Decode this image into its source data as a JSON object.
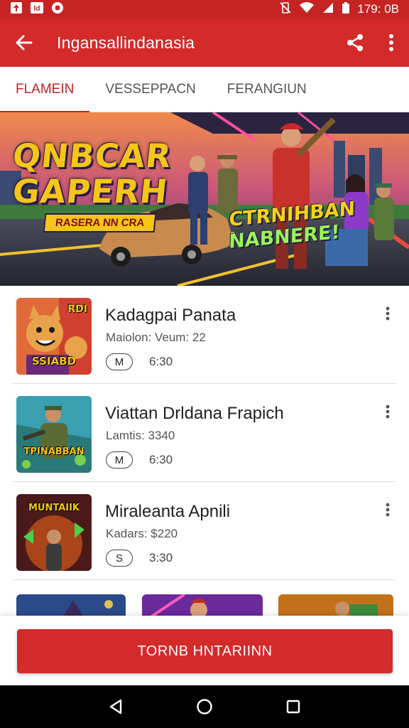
{
  "status_bar": {
    "time": "179: 0B",
    "icons": [
      "notification-icon",
      "image-icon",
      "circle-app-icon",
      "vibrate-off-icon",
      "wifi-icon",
      "signal-icon",
      "battery-icon"
    ]
  },
  "app_bar": {
    "title": "Ingansallindanasia",
    "back_icon": "arrow-left-icon",
    "share_icon": "share-icon",
    "more_icon": "more-vert-icon"
  },
  "tabs": [
    {
      "label": "FLAMEIN",
      "active": true
    },
    {
      "label": "VESSEPPACN",
      "active": false
    },
    {
      "label": "FERANGIUN",
      "active": false
    }
  ],
  "banner": {
    "title_line1": "QNBCAR",
    "title_line2": "GAPERH",
    "subtitle": "RASERA NN CRA",
    "slogan_line1": "CTRNIHBAN",
    "slogan_line2": "NABNERE!"
  },
  "items": [
    {
      "title": "Kadagpai Panata",
      "subtitle": "Maiolon: Veum: 22",
      "badge": "M",
      "time": "6:30",
      "thumb_top": "RDI",
      "thumb_caption": "SSIABD"
    },
    {
      "title": "Viattan Drldana Frapich",
      "subtitle": "Lamtis: 3340",
      "badge": "M",
      "time": "6:30",
      "thumb_top": "",
      "thumb_caption": "TPINABBAN"
    },
    {
      "title": "Miraleanta Apnili",
      "subtitle": "Kadars: $220",
      "badge": "S",
      "time": "3:30",
      "thumb_top": "MUNTAIIK",
      "thumb_caption": ""
    }
  ],
  "cta": {
    "label": "TORNB HNTARIINN"
  },
  "nav": {
    "back_icon": "nav-back-icon",
    "home_icon": "nav-home-icon",
    "recents_icon": "nav-recents-icon"
  },
  "colors": {
    "primary": "#d32a2a",
    "status": "#c62323",
    "accent": "#f5c518"
  }
}
